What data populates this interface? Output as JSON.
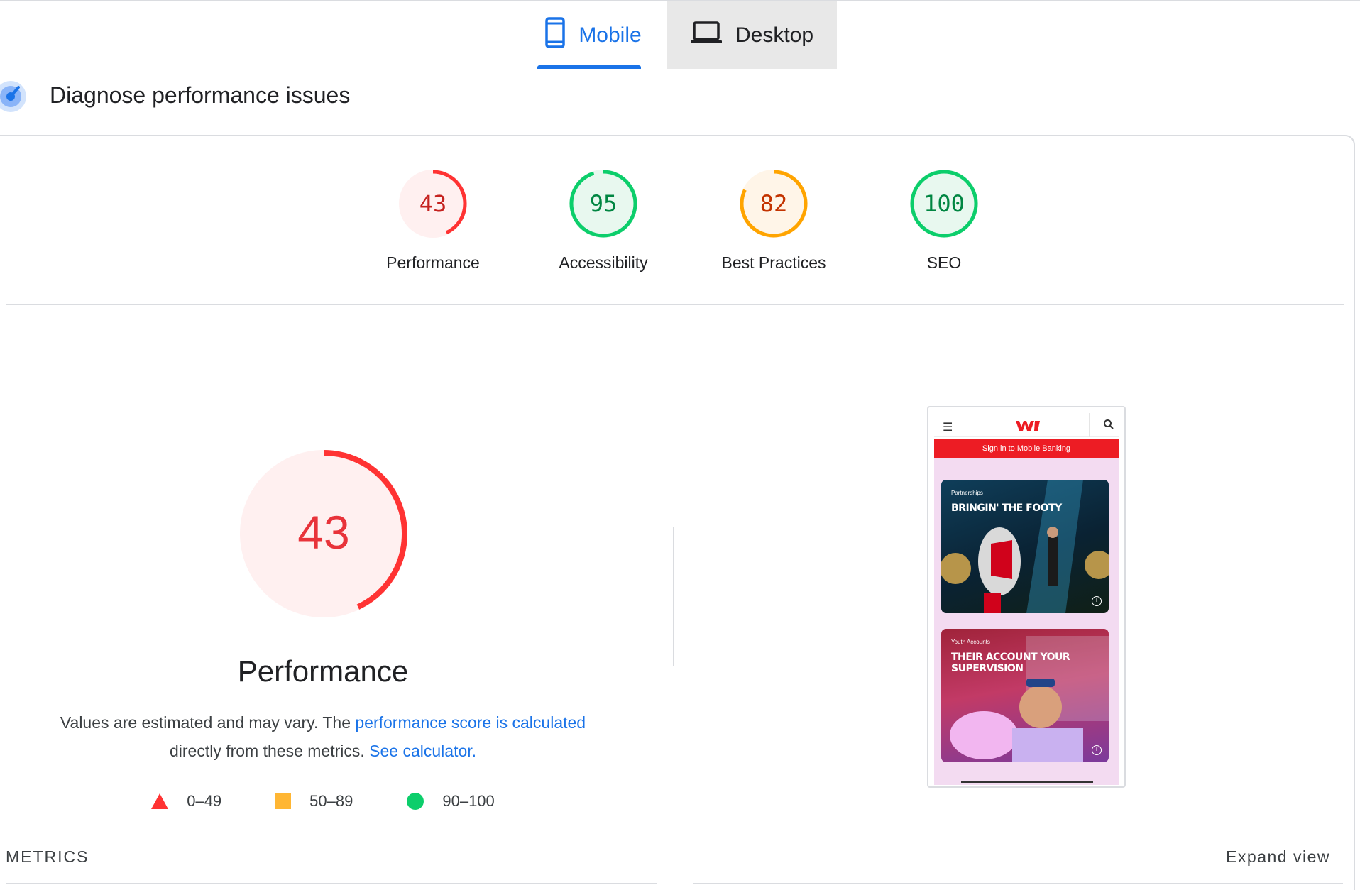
{
  "tabs": [
    {
      "label": "Mobile",
      "icon": "phone-icon",
      "selected": true
    },
    {
      "label": "Desktop",
      "icon": "laptop-icon",
      "selected": false
    }
  ],
  "header": {
    "title": "Diagnose performance issues",
    "icon": "lighthouse-gauge-icon"
  },
  "scores": [
    {
      "label": "Performance",
      "value": "43",
      "fraction": 0.43,
      "color": "#ff3333",
      "fill": "#fff0f0",
      "text_color": "#c5221f"
    },
    {
      "label": "Accessibility",
      "value": "95",
      "fraction": 0.95,
      "color": "#0cce6b",
      "fill": "#e8f8ef",
      "text_color": "#018642"
    },
    {
      "label": "Best Practices",
      "value": "82",
      "fraction": 0.82,
      "color": "#ffa400",
      "fill": "#fff5e8",
      "text_color": "#c33300"
    },
    {
      "label": "SEO",
      "value": "100",
      "fraction": 1.0,
      "color": "#0cce6b",
      "fill": "#e8f8ef",
      "text_color": "#018642"
    }
  ],
  "performance": {
    "score": "43",
    "fraction": 0.43,
    "title": "Performance",
    "desc_prefix": "Values are estimated and may vary. The ",
    "desc_link1": "performance score is calculated",
    "desc_middle": "directly from these metrics. ",
    "desc_link2": "See calculator."
  },
  "legend": [
    {
      "shape": "triangle",
      "range": "0–49",
      "color": "#ff3333"
    },
    {
      "shape": "square",
      "range": "50–89",
      "color": "#ffa400"
    },
    {
      "shape": "circle",
      "range": "90–100",
      "color": "#0cce6b"
    }
  ],
  "screenshot": {
    "banner": "Sign in to Mobile Banking",
    "card1_kicker": "Partnerships",
    "card1_headline": "BRINGIN' THE FOOTY",
    "card2_kicker": "Youth Accounts",
    "card2_headline_1": "THEIR ACCOUNT YOUR",
    "card2_headline_2": "SUPERVISION"
  },
  "footer": {
    "metrics_label": "METRICS",
    "expand_label": "Expand view"
  }
}
